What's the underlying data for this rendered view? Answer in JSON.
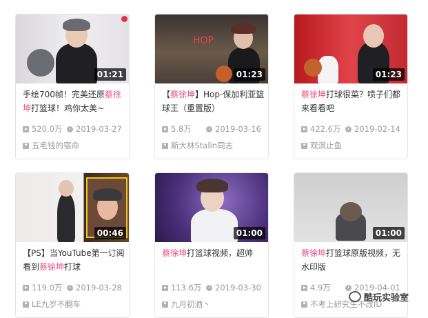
{
  "videos": [
    {
      "title_pre": "手绘700帧！完美还原",
      "title_hl": "蔡徐坤",
      "title_post": "打篮球！鸡你太美~",
      "duration": "01:21",
      "views": "520.0万",
      "date": "2019-03-27",
      "uploader": "五毛钱的宿命"
    },
    {
      "title_pre": "【",
      "title_hl": "蔡徐坤",
      "title_post": "】Hop-保加利亚篮球王（重置版）",
      "duration": "01:23",
      "views": "5.8万",
      "date": "2019-03-16",
      "uploader": "斯大林Stalin同志",
      "thumb_text": "HOP"
    },
    {
      "title_pre": "",
      "title_hl": "蔡徐坤",
      "title_post": "打球很菜？喷子们都来看看吧",
      "duration": "01:23",
      "views": "422.6万",
      "date": "2019-02-14",
      "uploader": "观溟止鱼"
    },
    {
      "title_pre": "【PS】当YouTube第一订阅看到",
      "title_hl": "蔡徐坤",
      "title_post": "打球",
      "duration": "00:46",
      "views": "119.0万",
      "date": "2019-03-28",
      "uploader": "LE九岁不翻车"
    },
    {
      "title_pre": "",
      "title_hl": "蔡徐坤",
      "title_post": "打篮球视频，超帅",
      "duration": "01:00",
      "views": "113.6万",
      "date": "2019-03-30",
      "uploader": "九月初酒丶"
    },
    {
      "title_pre": "",
      "title_hl": "蔡徐坤",
      "title_post": "打篮球原版视频，无水印版",
      "duration": "01:00",
      "views": "4.9万",
      "date": "2019-04-01",
      "uploader": "不考上研究生不改ID"
    }
  ],
  "watermark": "酷玩实验室",
  "colors": {
    "highlight": "#e8508a",
    "meta": "#999999",
    "border": "#e5e5e5"
  },
  "icons": {
    "views": "play-icon",
    "date": "clock-icon",
    "uploader": "user-icon"
  }
}
